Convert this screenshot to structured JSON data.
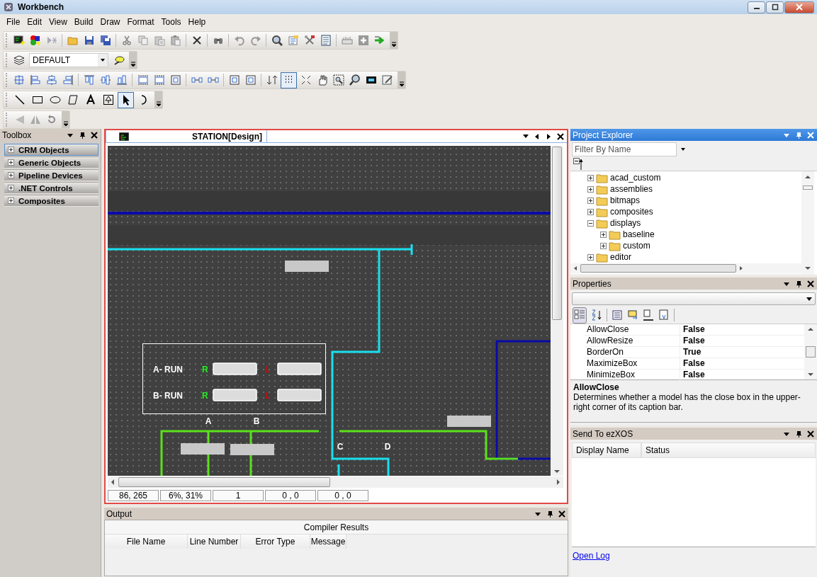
{
  "window": {
    "title": "Workbench"
  },
  "menu": [
    "File",
    "Edit",
    "View",
    "Build",
    "Draw",
    "Format",
    "Tools",
    "Help"
  ],
  "layer_combo": {
    "value": "DEFAULT"
  },
  "layout_toolbar": {
    "grid_on": true
  },
  "draw_tools": [
    {
      "kind": "line",
      "selected": false
    },
    {
      "kind": "rect",
      "selected": false
    },
    {
      "kind": "ellipse",
      "selected": false
    },
    {
      "kind": "polygon",
      "selected": false
    },
    {
      "kind": "text",
      "selected": false
    },
    {
      "kind": "symbol",
      "selected": false
    },
    {
      "kind": "pointer",
      "selected": true
    },
    {
      "kind": "arc",
      "selected": false
    }
  ],
  "toolbox": {
    "title": "Toolbox",
    "groups": [
      {
        "label": "CRM Objects",
        "selected": true
      },
      {
        "label": "Generic Objects",
        "selected": false
      },
      {
        "label": "Pipeline Devices",
        "selected": false
      },
      {
        "label": ".NET Controls",
        "selected": false
      },
      {
        "label": "Composites",
        "selected": false
      }
    ]
  },
  "document": {
    "tab": "STATION[Design]",
    "canvas": {
      "panel_rows": [
        {
          "label": "A- RUN",
          "right": "R",
          "left": "L"
        },
        {
          "label": "B- RUN",
          "right": "R",
          "left": "L"
        }
      ],
      "bus_labels": [
        "A",
        "B",
        "C",
        "D"
      ]
    },
    "status": [
      "86, 265",
      "6%, 31%",
      "1",
      "0 , 0",
      "0 , 0"
    ]
  },
  "output": {
    "title": "Output",
    "section": "Compiler Results",
    "columns": [
      "File Name",
      "Line Number",
      "Error Type",
      "Message"
    ]
  },
  "project_explorer": {
    "title": "Project Explorer",
    "filter": {
      "placeholder": "Filter By Name"
    },
    "tree": [
      {
        "label": "acad_custom",
        "expanded": false
      },
      {
        "label": "assemblies",
        "expanded": false
      },
      {
        "label": "bitmaps",
        "expanded": false
      },
      {
        "label": "composites",
        "expanded": false
      },
      {
        "label": "displays",
        "expanded": true,
        "children": [
          {
            "label": "baseline",
            "expanded": false
          },
          {
            "label": "custom",
            "expanded": false
          }
        ]
      },
      {
        "label": "editor",
        "expanded": false
      }
    ]
  },
  "properties": {
    "title": "Properties",
    "rows": [
      {
        "name": "AllowClose",
        "value": "False"
      },
      {
        "name": "AllowResize",
        "value": "False"
      },
      {
        "name": "BorderOn",
        "value": "True"
      },
      {
        "name": "MaximizeBox",
        "value": "False"
      },
      {
        "name": "MinimizeBox",
        "value": "False"
      }
    ],
    "description": {
      "title": "AllowClose",
      "text": "Determines whether a model has the close box in the upper-right corner of its caption bar."
    }
  },
  "send_panel": {
    "title": "Send To ezXOS",
    "columns": [
      "Display Name",
      "Status"
    ],
    "link": "Open Log"
  }
}
